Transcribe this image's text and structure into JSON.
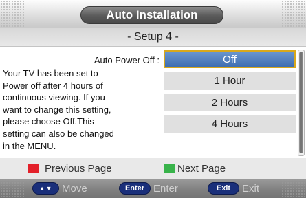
{
  "header": {
    "title": "Auto Installation",
    "subtitle": "- Setup 4 -"
  },
  "setting": {
    "label": "Auto Power Off :",
    "help_lines": [
      "Your TV has been set to",
      "Power off after 4 hours of",
      "continuous viewing. If you",
      "want to change this setting,",
      "please choose Off.This",
      "setting can also be changed",
      "in the MENU."
    ],
    "options": [
      "Off",
      "1 Hour",
      "2 Hours",
      "4 Hours"
    ],
    "selected": "Off"
  },
  "page_nav": {
    "previous_label": "Previous Page",
    "previous_color": "#e3202a",
    "next_label": "Next Page",
    "next_color": "#38b34a"
  },
  "footer": {
    "move_key": "▲▼",
    "move_label": "Move",
    "enter_key": "Enter",
    "enter_label": "Enter",
    "exit_key": "Exit",
    "exit_label": "Exit"
  },
  "colors": {
    "selected_fill": "#4a78b8",
    "selected_border": "#d8a81c",
    "key_pill": "#1a2f7a"
  }
}
